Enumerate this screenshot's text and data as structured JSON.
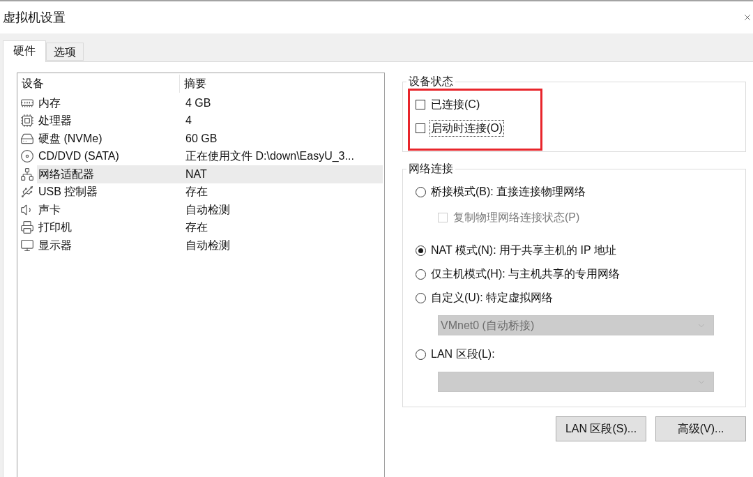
{
  "window": {
    "title": "虚拟机设置"
  },
  "tabs": [
    {
      "label": "硬件",
      "selected": true
    },
    {
      "label": "选项",
      "selected": false
    }
  ],
  "devices": {
    "columns": [
      "设备",
      "摘要"
    ],
    "rows": [
      {
        "kind": "memory",
        "name": "内存",
        "summary": "4 GB",
        "selected": false
      },
      {
        "kind": "cpu",
        "name": "处理器",
        "summary": "4",
        "selected": false
      },
      {
        "kind": "disk",
        "name": "硬盘 (NVMe)",
        "summary": "60 GB",
        "selected": false
      },
      {
        "kind": "cd",
        "name": "CD/DVD (SATA)",
        "summary": "正在使用文件 D:\\down\\EasyU_3...",
        "selected": false
      },
      {
        "kind": "network",
        "name": "网络适配器",
        "summary": "NAT",
        "selected": true
      },
      {
        "kind": "usb",
        "name": "USB 控制器",
        "summary": "存在",
        "selected": false
      },
      {
        "kind": "sound",
        "name": "声卡",
        "summary": "自动检测",
        "selected": false
      },
      {
        "kind": "printer",
        "name": "打印机",
        "summary": "存在",
        "selected": false
      },
      {
        "kind": "display",
        "name": "显示器",
        "summary": "自动检测",
        "selected": false
      }
    ]
  },
  "device_status": {
    "title": "设备状态",
    "highlighted": true,
    "options": [
      {
        "label": "已连接(C)",
        "checked": false,
        "focused": false
      },
      {
        "label": "启动时连接(O)",
        "checked": false,
        "focused": true
      }
    ]
  },
  "network_connection": {
    "title": "网络连接",
    "items": [
      {
        "kind": "radio",
        "label": "桥接模式(B): 直接连接物理网络",
        "selected": false
      },
      {
        "kind": "checkbox",
        "label": "复制物理网络连接状态(P)",
        "checked": false,
        "disabled": true
      },
      {
        "kind": "radio",
        "label": "NAT 模式(N): 用于共享主机的 IP 地址",
        "selected": true
      },
      {
        "kind": "radio",
        "label": "仅主机模式(H): 与主机共享的专用网络",
        "selected": false
      },
      {
        "kind": "radio",
        "label": "自定义(U): 特定虚拟网络",
        "selected": false
      },
      {
        "kind": "dropdown",
        "value": "VMnet0 (自动桥接)",
        "disabled": true
      },
      {
        "kind": "radio",
        "label": "LAN 区段(L):",
        "selected": false
      },
      {
        "kind": "dropdown",
        "disabled": true
      }
    ]
  },
  "buttons": [
    {
      "label": "LAN 区段(S)..."
    },
    {
      "label": "高级(V)..."
    }
  ]
}
